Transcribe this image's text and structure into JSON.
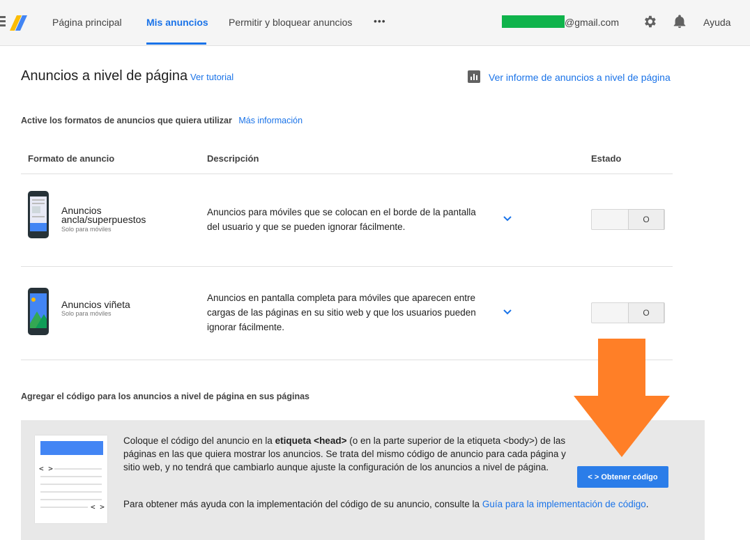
{
  "topbar": {
    "nav": [
      "Página principal",
      "Mis anuncios",
      "Permitir y bloquear anuncios",
      "•••"
    ],
    "active_index": 1,
    "email": "@gmail.com",
    "help": "Ayuda",
    "icons": [
      "menu-icon",
      "adsense-logo-icon",
      "gear-icon",
      "bell-icon"
    ]
  },
  "header": {
    "title": "Anuncios a nivel de página",
    "tutorial_link": "Ver tutorial",
    "report_link": "Ver informe de anuncios a nivel de página"
  },
  "formats_section": {
    "label": "Active los formatos de anuncios que quiera utilizar",
    "more_info": "Más información"
  },
  "table": {
    "headers": [
      "Formato de anuncio",
      "Descripción",
      "Estado"
    ],
    "rows": [
      {
        "name": "Anuncios ancla/superpuestos",
        "sub": "Solo para móviles",
        "description": "Anuncios para móviles que se colocan en el borde de la pantalla del usuario y que se pueden ignorar fácilmente.",
        "state": "O"
      },
      {
        "name": "Anuncios viñeta",
        "sub": "Solo para móviles",
        "description": "Anuncios en pantalla completa para móviles que aparecen entre cargas de las páginas en su sitio web y que los usuarios pueden ignorar fácilmente.",
        "state": "O"
      }
    ]
  },
  "code_section": {
    "label": "Agregar el código para los anuncios a nivel de página en sus páginas",
    "text_pre": "Coloque el código del anuncio en la ",
    "text_bold": "etiqueta <head>",
    "text_post": " (o en la parte superior de la etiqueta <body>) de las páginas en las que quiera mostrar los anuncios. Se trata del mismo código de anuncio para cada página y sitio web, y no tendrá que cambiarlo aunque ajuste la configuración de los anuncios a nivel de página.",
    "help_text": "Para obtener más ayuda con la implementación del código de su anuncio, consulte la ",
    "help_link": "Guía para la implementación de código",
    "help_end": ".",
    "button": "< > Obtener código",
    "code_glyph": "< >"
  },
  "colors": {
    "accent": "#1a73e8",
    "annotation_arrow": "#ff7f27",
    "email_mask": "#0fb34b"
  }
}
